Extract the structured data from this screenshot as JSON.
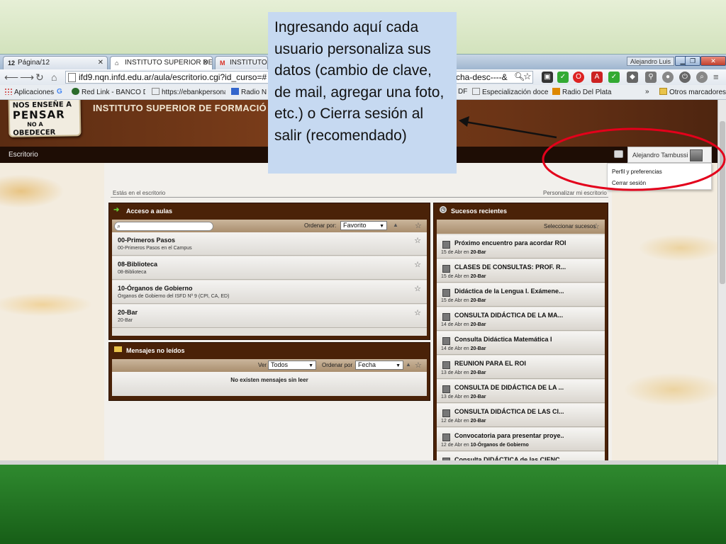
{
  "browser": {
    "tabs": [
      {
        "favicon": "12",
        "label": "Página/12"
      },
      {
        "favicon": "house-icon",
        "label": "INSTITUTO SUPERIOR DE"
      },
      {
        "favicon": "gmail-icon",
        "label": "INSTITUTO SU"
      }
    ],
    "window_user": "Alejandro Luis",
    "url_left": "ifd9.nqn.infd.edu.ar/aula/escritorio.cgi?id_curso=#",
    "url_right": "cha-desc----&",
    "bookmarks": [
      "Aplicaciones",
      "Red Link - BANCO DE",
      "https://ebankpersona",
      "Radio Na",
      "DF",
      "Especialización doce",
      "Radio Del Plata",
      "»",
      "Otros marcadores"
    ],
    "colors": {
      "bookmark_folder": "#e8c34a",
      "gmail": "#d93025"
    }
  },
  "site": {
    "logo": {
      "line1": "NOS ENSEÑE A",
      "line2": "PENSAR",
      "line3": "NO A",
      "line4": "OBEDECER"
    },
    "title": "INSTITUTO SUPERIOR DE FORMACIÓ",
    "menu": {
      "escritorio": "Escritorio"
    },
    "user_name": "Alejandro Tambussi",
    "user_menu": [
      "Perfil y preferencias",
      "Cerrar sesión"
    ],
    "breadcrumb": "Estás en el escritorio",
    "customize": "Personalizar mi escritorio"
  },
  "acceso": {
    "title": "Acceso a aulas",
    "sort_label": "Ordenar por:",
    "sort_value": "Favorito",
    "courses": [
      {
        "name": "00-Primeros Pasos",
        "sub": "00-Primeros Pasos en el Campus"
      },
      {
        "name": "08-Biblioteca",
        "sub": "08-Biblioteca"
      },
      {
        "name": "10-Órganos de Gobierno",
        "sub": "Órganos de Gobierno del ISFD Nº 9 (CPI, CA, ED)"
      },
      {
        "name": "20-Bar",
        "sub": "20-Bar"
      }
    ]
  },
  "mensajes": {
    "title": "Mensajes no leídos",
    "ver_label": "Ver",
    "ver_value": "Todos",
    "sort_label": "Ordenar por",
    "sort_value": "Fecha",
    "empty": "No existen mensajes sin leer"
  },
  "sucesos": {
    "title": "Sucesos recientes",
    "select": "Seleccionar sucesos",
    "events": [
      {
        "title": "Próximo encuentro para acordar ROI",
        "date": "15 de Abr en",
        "where": "20-Bar"
      },
      {
        "title": "CLASES DE CONSULTAS: PROF. R...",
        "date": "15 de Abr en",
        "where": "20-Bar"
      },
      {
        "title": "Didáctica de la Lengua I. Exámene...",
        "date": "15 de Abr en",
        "where": "20-Bar"
      },
      {
        "title": "CONSULTA DIDÁCTICA DE LA MA...",
        "date": "14 de Abr en",
        "where": "20-Bar"
      },
      {
        "title": "Consulta Didáctica Matemática I",
        "date": "14 de Abr en",
        "where": "20-Bar"
      },
      {
        "title": "REUNION PARA EL ROI",
        "date": "13 de Abr en",
        "where": "20-Bar"
      },
      {
        "title": "CONSULTA DE DIDÁCTICA DE LA ...",
        "date": "13 de Abr en",
        "where": "20-Bar"
      },
      {
        "title": "CONSULTA DIDÁCTICA DE LAS CI...",
        "date": "12 de Abr en",
        "where": "20-Bar"
      },
      {
        "title": "Convocatoria para presentar proye..",
        "date": "12 de Abr en",
        "where": "10-Órganos de Gobierno"
      },
      {
        "title": "Consulta DIDÁCTICA de las CIENC...",
        "date": "",
        "where": ""
      }
    ]
  },
  "annotation": {
    "text": "Ingresando aquí cada usuario personaliza sus datos (cambio de clave, de mail, agregar una foto, etc.) o Cierra sesión al salir (recomendado)",
    "highlight_color": "#e3001b",
    "callout_bg": "#c6d9f1"
  }
}
